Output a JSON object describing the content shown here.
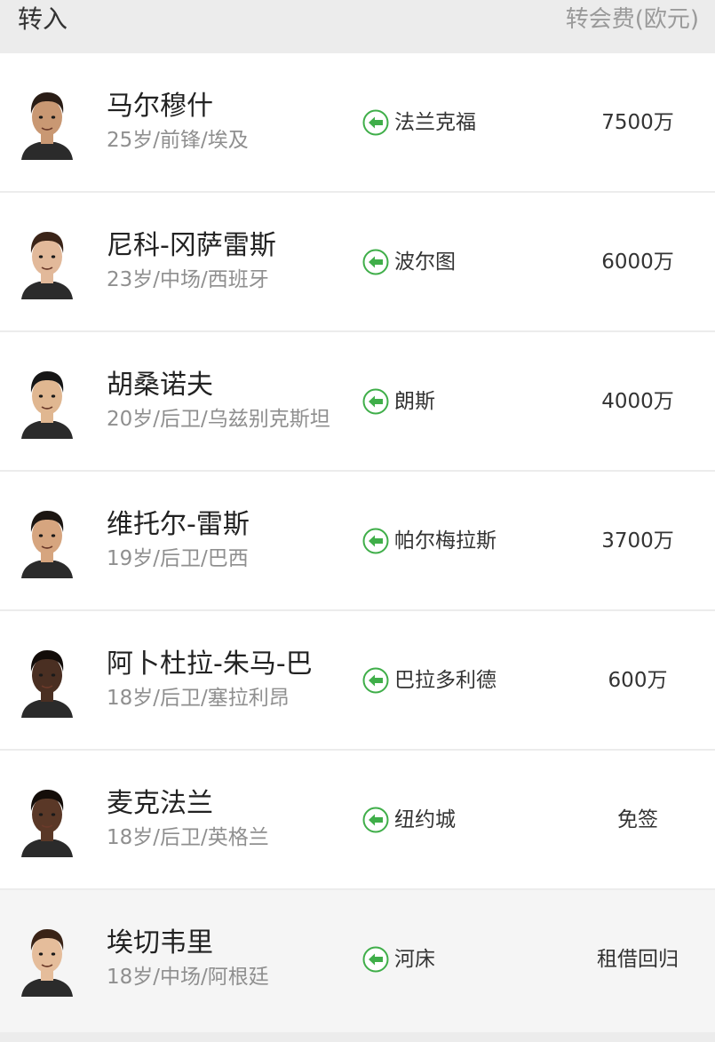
{
  "header": {
    "title": "转入",
    "fee_label": "转会费(欧元)"
  },
  "transfers": [
    {
      "name": "马尔穆什",
      "info": "25岁/前锋/埃及",
      "from_club": "法兰克福",
      "fee": "7500万",
      "skin": "#c99873",
      "hair": "#2a1d16"
    },
    {
      "name": "尼科-冈萨雷斯",
      "info": "23岁/中场/西班牙",
      "from_club": "波尔图",
      "fee": "6000万",
      "skin": "#e2b99a",
      "hair": "#3b2418"
    },
    {
      "name": "胡桑诺夫",
      "info": "20岁/后卫/乌兹别克斯坦",
      "from_club": "朗斯",
      "fee": "4000万",
      "skin": "#e0b791",
      "hair": "#161616"
    },
    {
      "name": "维托尔-雷斯",
      "info": "19岁/后卫/巴西",
      "from_club": "帕尔梅拉斯",
      "fee": "3700万",
      "skin": "#d6a57f",
      "hair": "#1c1612"
    },
    {
      "name": "阿卜杜拉-朱马-巴",
      "info": "18岁/后卫/塞拉利昂",
      "from_club": "巴拉多利德",
      "fee": "600万",
      "skin": "#4a2f22",
      "hair": "#120c09"
    },
    {
      "name": "麦克法兰",
      "info": "18岁/后卫/英格兰",
      "from_club": "纽约城",
      "fee": "免签",
      "skin": "#5a3827",
      "hair": "#140d09"
    },
    {
      "name": "埃切韦里",
      "info": "18岁/中场/阿根廷",
      "from_club": "河床",
      "fee": "租借回归",
      "skin": "#e5bd9b",
      "hair": "#3a2316"
    }
  ],
  "colors": {
    "arrow_green": "#3fae49",
    "background": "#ececec"
  },
  "icons": {
    "transfer_in": "arrow-left-circle-icon"
  }
}
